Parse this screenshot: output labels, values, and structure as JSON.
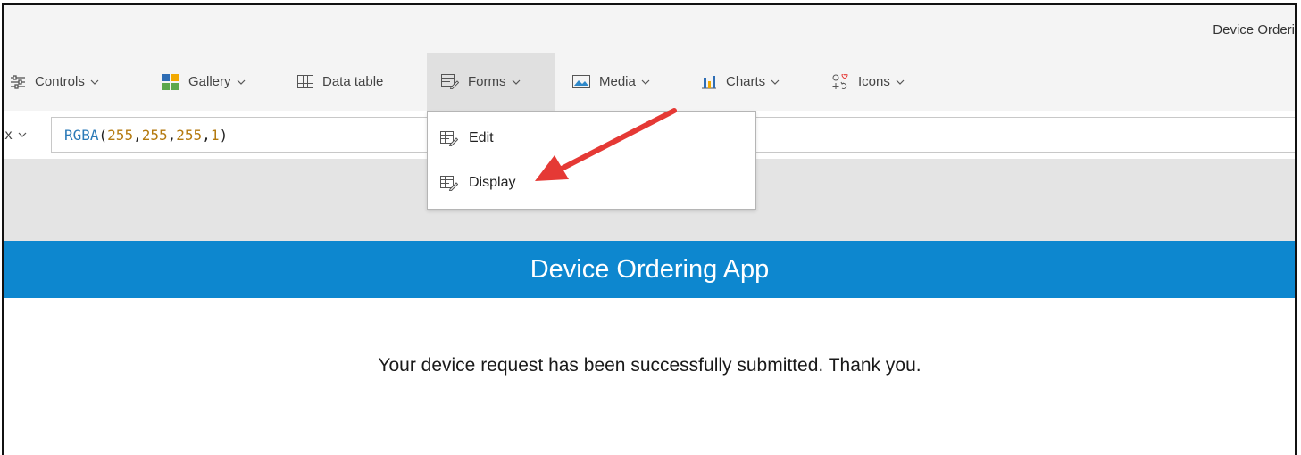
{
  "window": {
    "title": "Device Orderi"
  },
  "ribbon": {
    "items": [
      {
        "label": "Controls",
        "icon": "sliders-icon"
      },
      {
        "label": "Gallery",
        "icon": "gallery-icon"
      },
      {
        "label": "Data table",
        "icon": "table-icon"
      },
      {
        "label": "Forms",
        "icon": "form-icon",
        "active": true
      },
      {
        "label": "Media",
        "icon": "image-icon"
      },
      {
        "label": "Charts",
        "icon": "bar-chart-icon"
      },
      {
        "label": "Icons",
        "icon": "shapes-icon"
      }
    ]
  },
  "formula_bar": {
    "selector": "x",
    "function_name": "RGBA",
    "args": [
      "255",
      "255",
      "255",
      "1"
    ]
  },
  "forms_menu": {
    "items": [
      {
        "label": "Edit",
        "icon": "form-icon"
      },
      {
        "label": "Display",
        "icon": "form-icon"
      }
    ]
  },
  "screen": {
    "header_title": "Device Ordering App",
    "message": "Your device request has been successfully submitted. Thank you.",
    "header_color": "#0d87cf"
  },
  "annotation": {
    "arrow_color": "#e53935"
  }
}
